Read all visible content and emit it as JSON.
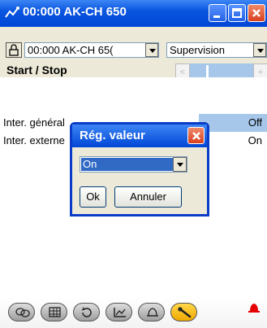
{
  "window": {
    "title": "00:000 AK-CH 650"
  },
  "toolbar": {
    "device_combo": "00:000 AK-CH 65(",
    "mode_combo": "Supervision",
    "section_label": "Start / Stop",
    "scroll_prev": "<",
    "scroll_next": "+"
  },
  "rows": [
    {
      "name": "Inter. général",
      "value": "Off"
    },
    {
      "name": "Inter. externe",
      "value": "On"
    }
  ],
  "dialog": {
    "title": "Rég. valeur",
    "selected": "On",
    "ok_label": "Ok",
    "cancel_label": "Annuler"
  },
  "bottombar": {
    "icons": [
      "chat-icon",
      "grid-icon",
      "refresh-icon",
      "graph-icon",
      "alarm-bell-icon",
      "wrench-icon"
    ],
    "active_icon": "wrench-icon",
    "alarm_color": "#e60000"
  }
}
